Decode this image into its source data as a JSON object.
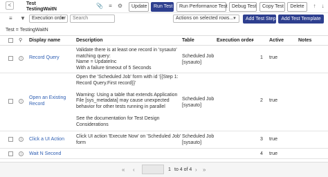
{
  "header": {
    "title_line1": "Test",
    "title_line2": "TestingWaitN",
    "buttons": {
      "update": "Update",
      "run_test": "Run Test",
      "run_perf": "Run Performance Test",
      "debug": "Debug Test",
      "copy": "Copy Test",
      "delete": "Delete"
    }
  },
  "toolbar": {
    "sort_field": "Execution order",
    "search_placeholder": "Search",
    "actions": "Actions on selected rows...",
    "add_step": "Add Test Step",
    "add_template": "Add Test Template"
  },
  "breadcrumb": "Test = TestingWaitN",
  "columns": {
    "display_name": "Display name",
    "description": "Description",
    "table": "Table",
    "execution_order": "Execution order",
    "active": "Active",
    "notes": "Notes"
  },
  "rows": [
    {
      "display_name": "Record Query",
      "description": [
        "Validate there is at least one record in 'sysauto'",
        "matching query:",
        "Name = UpdateInc",
        "With a failure timeout of 5 Seconds"
      ],
      "table_line1": "Scheduled Job",
      "table_line2": "[sysauto]",
      "order": "1",
      "active": "true"
    },
    {
      "display_name": "Open an Existing Record",
      "description": [
        "Open the 'Scheduled Job' form with id '{{Step 1:",
        "Record Query.First record}}'",
        "",
        "Warning: Using a table that extends Application",
        "File [sys_metadata] may cause unexpected",
        "behavior for other tests running in parallel",
        "",
        "See the documentation for Test Design",
        "Considerations"
      ],
      "table_line1": "Scheduled Job",
      "table_line2": "[sysauto]",
      "order": "2",
      "active": "true"
    },
    {
      "display_name": "Click a UI Action",
      "description": [
        "Click UI action 'Execute Now' on 'Scheduled Job'",
        "form"
      ],
      "table_line1": "Scheduled Job",
      "table_line2": "[sysauto]",
      "order": "3",
      "active": "true"
    },
    {
      "display_name": "Wait N Second",
      "description": [],
      "table_line1": "",
      "table_line2": "",
      "order": "4",
      "active": "true"
    }
  ],
  "pager": {
    "current": "1",
    "range_text": "to 4 of 4"
  },
  "colors": {
    "primary": "#2e3f8f",
    "link": "#2f5fb3"
  }
}
